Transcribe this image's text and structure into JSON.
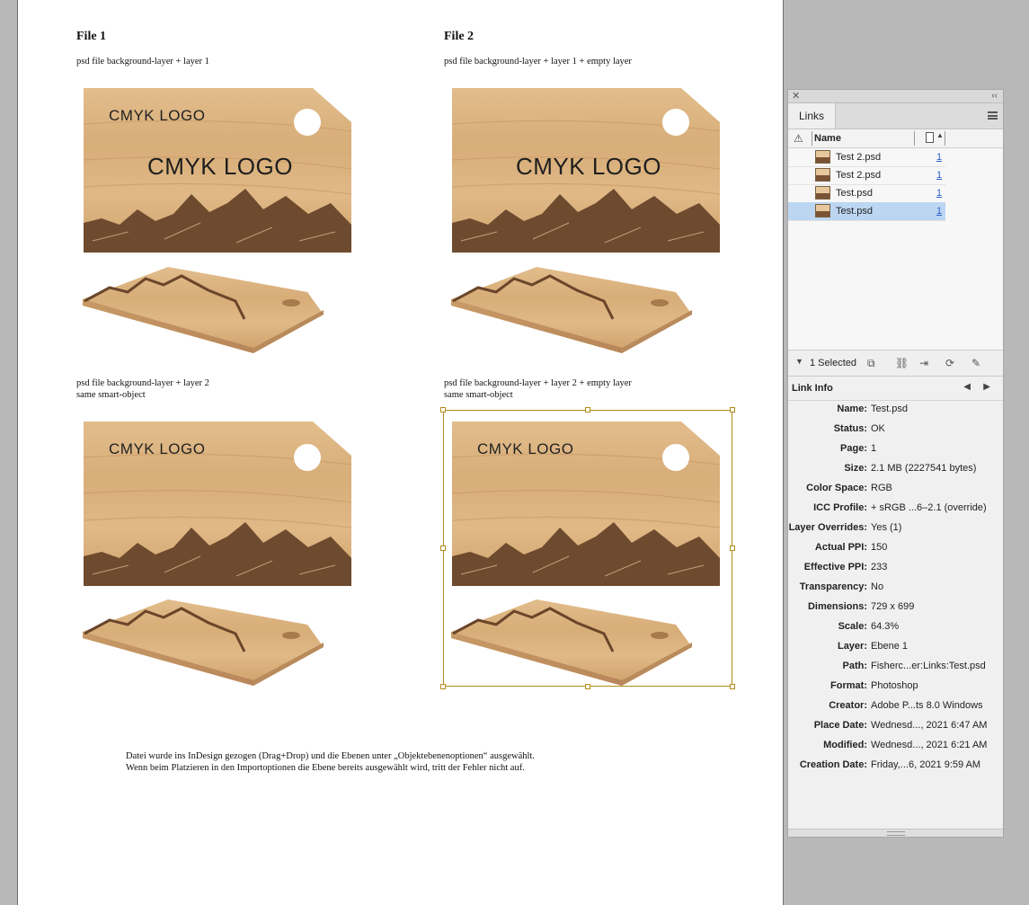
{
  "document": {
    "file1_title": "File 1",
    "file2_title": "File 2",
    "caption_top_left": "psd file background-layer + layer 1",
    "caption_top_right": "psd file background-layer + layer 1 + empty layer",
    "caption_bottom_left_1": "psd file background-layer + layer 2",
    "caption_bottom_left_2": "same smart-object",
    "caption_bottom_right_1": "psd file background-layer + layer 2 + empty layer",
    "caption_bottom_right_2": "same smart-object",
    "logo_text": "CMYK LOGO",
    "note_line1": "Datei wurde ins InDesign gezogen (Drag+Drop) und die Ebenen unter „Objektebenenoptionen“ ausgewählt.",
    "note_line2": "Wenn beim Platzieren in den Importoptionen die Ebene bereits ausgewählt wird, tritt der Fehler nicht auf."
  },
  "links_panel": {
    "tab_label": "Links",
    "col_name": "Name",
    "rows": [
      {
        "name": "Test 2.psd",
        "page": "1"
      },
      {
        "name": "Test 2.psd",
        "page": "1"
      },
      {
        "name": "Test.psd",
        "page": "1"
      },
      {
        "name": "Test.psd",
        "page": "1"
      }
    ],
    "selected_text": "1 Selected",
    "link_info_title": "Link Info",
    "info": [
      {
        "label": "Name:",
        "value": "Test.psd"
      },
      {
        "label": "Status:",
        "value": "OK"
      },
      {
        "label": "Page:",
        "value": "1"
      },
      {
        "label": "Size:",
        "value": "2.1 MB (2227541 bytes)"
      },
      {
        "label": "Color Space:",
        "value": "RGB"
      },
      {
        "label": "ICC Profile:",
        "value": "+ sRGB ...6–2.1 (override)"
      },
      {
        "label": "Layer Overrides:",
        "value": "Yes (1)"
      },
      {
        "label": "Actual PPI:",
        "value": "150"
      },
      {
        "label": "Effective PPI:",
        "value": "233"
      },
      {
        "label": "Transparency:",
        "value": "No"
      },
      {
        "label": "Dimensions:",
        "value": "729 x 699"
      },
      {
        "label": "Scale:",
        "value": "64.3%"
      },
      {
        "label": "Layer:",
        "value": "Ebene 1"
      },
      {
        "label": "Path:",
        "value": "Fisherc...er:Links:Test.psd"
      },
      {
        "label": "Format:",
        "value": "Photoshop"
      },
      {
        "label": "Creator:",
        "value": "Adobe P...ts 8.0 Windows"
      },
      {
        "label": "Place Date:",
        "value": "Wednesd..., 2021 6:47 AM"
      },
      {
        "label": "Modified:",
        "value": "Wednesd..., 2021 6:21 AM"
      },
      {
        "label": "Creation Date:",
        "value": "Friday,...6, 2021 9:59 AM"
      }
    ]
  }
}
